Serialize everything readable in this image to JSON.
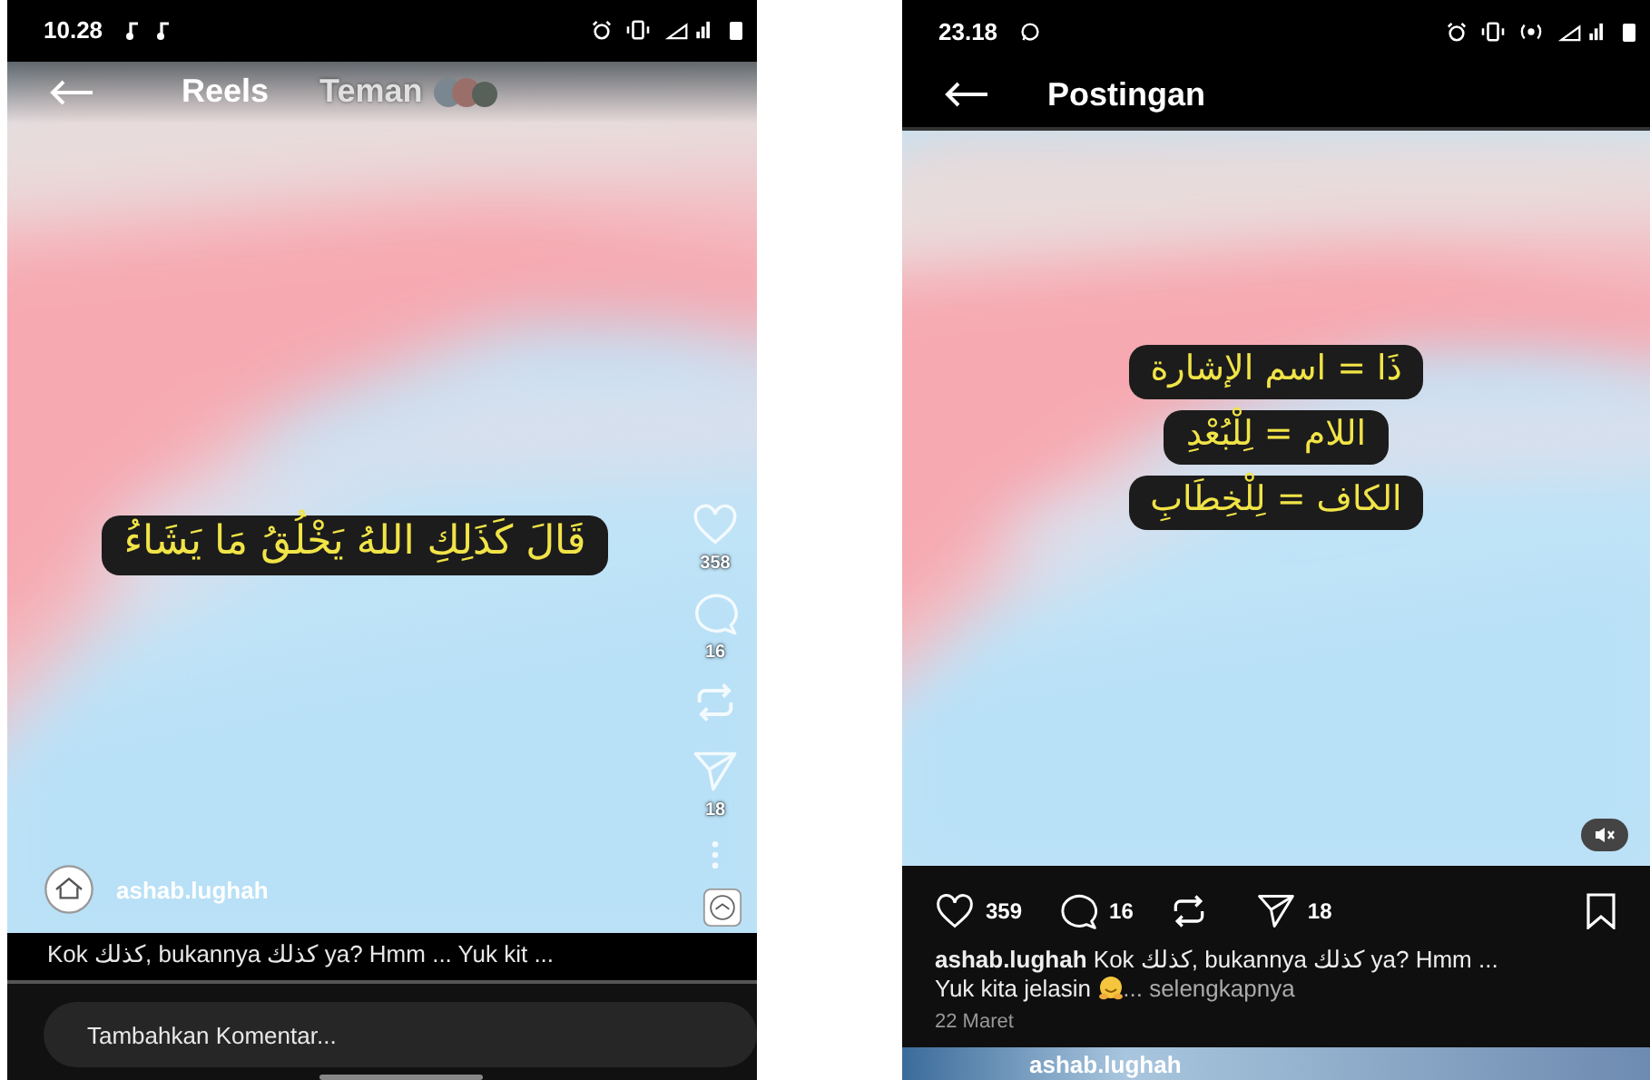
{
  "left": {
    "status_bar": {
      "time": "10.28"
    },
    "tabs": [
      {
        "label": "Reels",
        "selected": true
      },
      {
        "label": "Teman",
        "selected": false
      }
    ],
    "captions": [
      "قَالَ كَذَلِكِ اللهُ يَخْلُقُ مَا يَشَاءُ"
    ],
    "actions": [
      {
        "kind": "like",
        "count": "358"
      },
      {
        "kind": "comment",
        "count": "16"
      },
      {
        "kind": "repost"
      },
      {
        "kind": "share",
        "count": "18"
      },
      {
        "kind": "more"
      }
    ],
    "author": "ashab.lughah",
    "caption": "Kok كذلك, bukannya كذلك ya? Hmm ... Yuk kit ...",
    "comment_field": {
      "placeholder": "Tambahkan Komentar..."
    }
  },
  "right": {
    "status_bar": {
      "time": "23.18"
    },
    "title": "Postingan",
    "captions": [
      "ذَا = اسم الإشارة",
      "اللام = لِلْبُعْدِ",
      "الكاف = لِلْخِطَابِ"
    ],
    "actions": [
      {
        "kind": "like",
        "count": "359"
      },
      {
        "kind": "comment",
        "count": "16"
      },
      {
        "kind": "repost"
      },
      {
        "kind": "share",
        "count": "18"
      }
    ],
    "caption_lines": [
      "**ashab.lughah** Kok كذلك, bukannya كذلك ya? Hmm ...",
      "Yuk kita jelasin"
    ],
    "more_link": "... selengkapnya",
    "date": "22 Maret",
    "next_post_author": "ashab.lughah"
  }
}
